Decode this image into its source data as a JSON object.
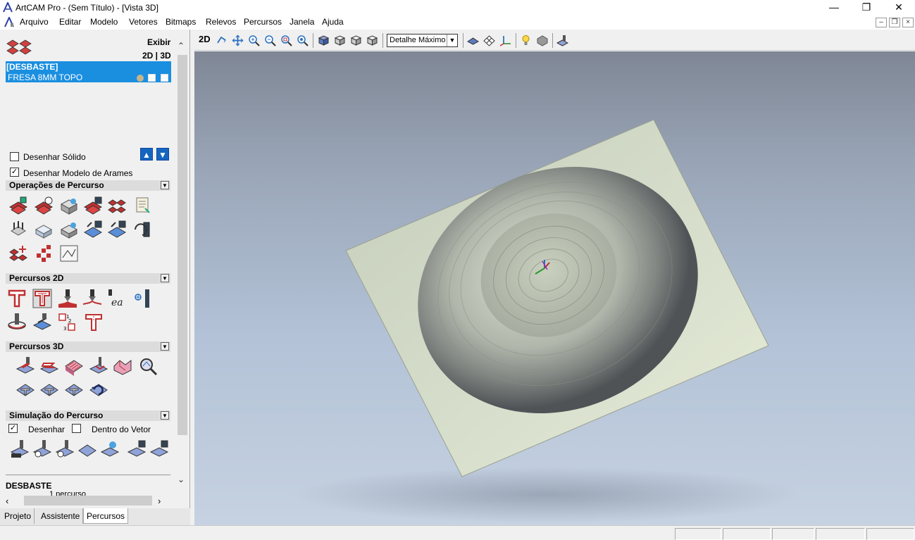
{
  "window": {
    "title": "ArtCAM Pro - (Sem Título) - [Vista 3D]",
    "minimize": "—",
    "restore": "❐",
    "close": "✕"
  },
  "menu": {
    "items": [
      "Arquivo",
      "Editar",
      "Modelo",
      "Vetores",
      "Bitmaps",
      "Relevos",
      "Percursos",
      "Janela",
      "Ajuda"
    ],
    "mdi_minimize": "–",
    "mdi_restore": "❐",
    "mdi_close": "×"
  },
  "panel": {
    "exibir": "Exibir",
    "view_toggle": "2D | 3D",
    "toolpath_group": "[DESBASTE]",
    "toolpath_tool": "FRESA 8MM TOPO",
    "draw_solid": "Desenhar Sólido",
    "draw_wireframe": "Desenhar Modelo de Arames",
    "draw_solid_checked": false,
    "draw_wireframe_checked": true,
    "up_icon": "arrow-up-icon",
    "down_icon": "arrow-down-icon",
    "sections": {
      "operations": "Operações de Percurso",
      "toolpaths_2d": "Percursos 2D",
      "toolpaths_3d": "Percursos 3D",
      "simulation": "Simulação do Percurso"
    },
    "sim_draw": "Desenhar",
    "sim_inside_vector": "Dentro do Vetor",
    "sim_draw_checked": true,
    "sim_inside_checked": false,
    "selected_name": "DESBASTE",
    "selected_count": "1 percurso",
    "tabs": [
      "Projeto",
      "Assistente",
      "Percursos"
    ],
    "active_tab": "Percursos"
  },
  "toolbar": {
    "mode_2d": "2D",
    "detail_level": "Detalhe Máximo"
  },
  "colors": {
    "selection": "#1a8fe0",
    "viewport_top": "#7f8795",
    "viewport_bottom": "#c6d2e1",
    "relief": "#d4dccb"
  }
}
